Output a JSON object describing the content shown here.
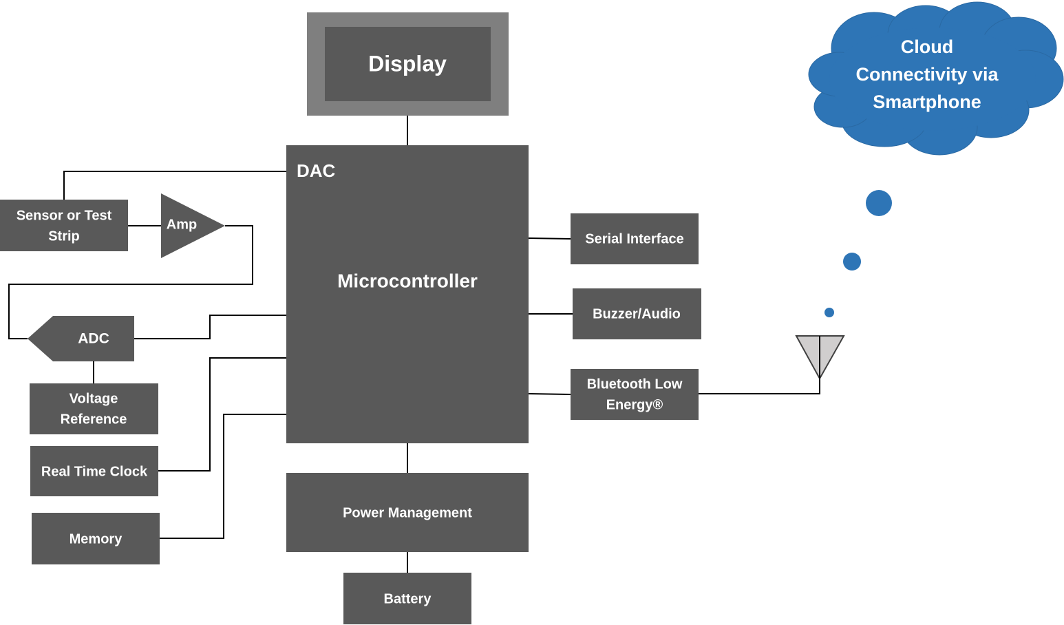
{
  "colors": {
    "block": "#595959",
    "display_frame": "#7f7f7f",
    "cloud": "#2e75b6",
    "antenna": "#d0cece",
    "text": "#ffffff"
  },
  "blocks": {
    "display": "Display",
    "dac": "DAC",
    "microcontroller": "Microcontroller",
    "sensor_line1": "Sensor or Test",
    "sensor_line2": "Strip",
    "amp": "Amp",
    "adc": "ADC",
    "voltage_line1": "Voltage",
    "voltage_line2": "Reference",
    "rtc": "Real Time Clock",
    "memory": "Memory",
    "power": "Power Management",
    "battery": "Battery",
    "serial": "Serial Interface",
    "buzzer": "Buzzer/Audio",
    "ble_line1": "Bluetooth Low",
    "ble_line2": "Energy®"
  },
  "cloud": {
    "line1": "Cloud",
    "line2": "Connectivity via",
    "line3": "Smartphone"
  },
  "icons": {
    "antenna": "antenna-icon",
    "cloud": "cloud-icon"
  }
}
